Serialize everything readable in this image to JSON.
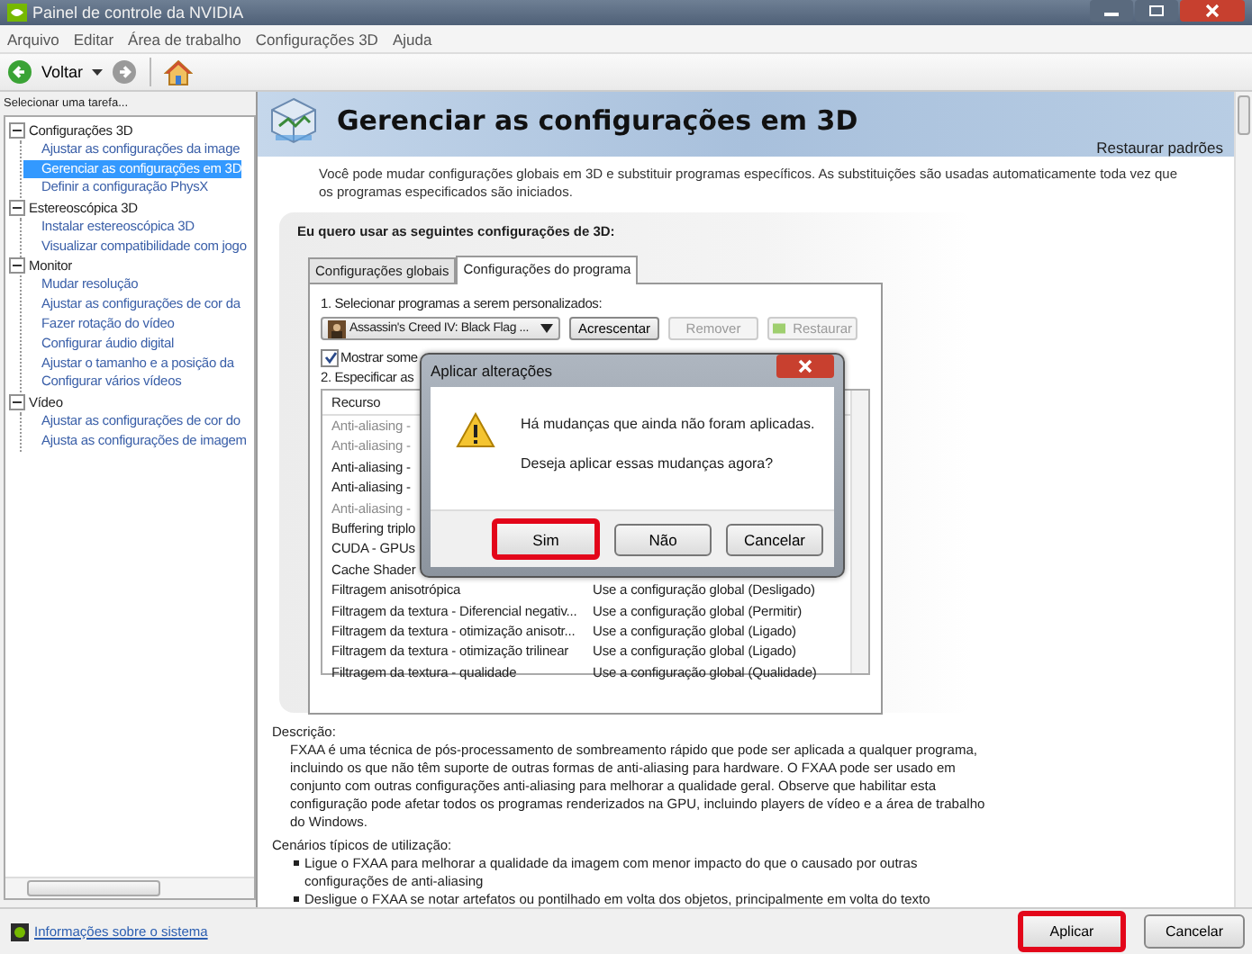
{
  "window": {
    "title": "Painel de controle da NVIDIA"
  },
  "menu": [
    "Arquivo",
    "Editar",
    "Área de trabalho",
    "Configurações 3D",
    "Ajuda"
  ],
  "toolbar": {
    "back_label": "Voltar"
  },
  "sidebar": {
    "heading": "Selecionar uma tarefa...",
    "tree": [
      {
        "label": "Configurações 3D",
        "expanded": true,
        "children": [
          {
            "label": "Ajustar as configurações da image",
            "selected": false
          },
          {
            "label": "Gerenciar as configurações em 3D",
            "selected": true
          },
          {
            "label": "Definir a configuração PhysX",
            "selected": false
          }
        ]
      },
      {
        "label": "Estereoscópica 3D",
        "expanded": true,
        "children": [
          {
            "label": "Instalar estereoscópica 3D",
            "selected": false
          },
          {
            "label": "Visualizar compatibilidade com jogo",
            "selected": false
          }
        ]
      },
      {
        "label": "Monitor",
        "expanded": true,
        "children": [
          {
            "label": "Mudar resolução",
            "selected": false
          },
          {
            "label": "Ajustar as configurações de cor da",
            "selected": false
          },
          {
            "label": "Fazer rotação do vídeo",
            "selected": false
          },
          {
            "label": "Configurar áudio digital",
            "selected": false
          },
          {
            "label": "Ajustar o tamanho e a posição da",
            "selected": false
          },
          {
            "label": "Configurar vários vídeos",
            "selected": false
          }
        ]
      },
      {
        "label": "Vídeo",
        "expanded": true,
        "children": [
          {
            "label": "Ajustar as configurações de cor do",
            "selected": false
          },
          {
            "label": "Ajusta as configurações de imagem",
            "selected": false
          }
        ]
      }
    ]
  },
  "page": {
    "title": "Gerenciar as configurações em 3D",
    "restore_link": "Restaurar padrões",
    "intro": "Você pode mudar configurações globais em 3D e substituir programas específicos. As substituições são usadas automaticamente toda vez que os programas especificados são iniciados.",
    "settings": {
      "heading": "Eu quero usar as seguintes configurações de 3D:",
      "tabs": [
        {
          "label": "Configurações globais",
          "selected": false
        },
        {
          "label": "Configurações do programa",
          "selected": true
        }
      ],
      "step1": "1. Selecionar programas a serem personalizados:",
      "program": "Assassin's Creed IV: Black Flag ...",
      "buttons": [
        {
          "label": "Acrescentar",
          "disabled": false
        },
        {
          "label": "Remover",
          "disabled": true
        },
        {
          "label": "Restaurar",
          "disabled": true
        }
      ],
      "show_only": {
        "label": "Mostrar some",
        "checked": true
      },
      "step2": "2. Especificar as",
      "table": {
        "columns": [
          "Recurso"
        ],
        "rows": [
          {
            "feature": "Anti-aliasing -",
            "disabled": true
          },
          {
            "feature": "Anti-aliasing -",
            "disabled": true
          },
          {
            "feature": "Anti-aliasing -",
            "disabled": false
          },
          {
            "feature": "Anti-aliasing -",
            "disabled": false
          },
          {
            "feature": "Anti-aliasing -",
            "disabled": true
          },
          {
            "feature": "Buffering triplo",
            "disabled": false
          },
          {
            "feature": "CUDA - GPUs",
            "disabled": false
          },
          {
            "feature": "Cache Shader",
            "disabled": false
          },
          {
            "feature": "Filtragem anisotrópica",
            "setting": "Use a configuração global (Desligado)",
            "disabled": false
          },
          {
            "feature": "Filtragem da textura - Diferencial negativ...",
            "setting": "Use a configuração global (Permitir)",
            "disabled": false
          },
          {
            "feature": "Filtragem da textura - otimização anisotr...",
            "setting": "Use a configuração global (Ligado)",
            "disabled": false
          },
          {
            "feature": "Filtragem da textura - otimização trilinear",
            "setting": "Use a configuração global (Ligado)",
            "disabled": false
          },
          {
            "feature": "Filtragem da textura - qualidade",
            "setting": "Use a configuração global (Qualidade)",
            "disabled": false
          }
        ]
      }
    },
    "description": {
      "heading": "Descrição:",
      "text": "FXAA é uma técnica de pós-processamento de sombreamento rápido que pode ser aplicada a qualquer programa, incluindo os que não têm suporte de outras formas de anti-aliasing para hardware. O FXAA pode ser usado em conjunto com outras configurações anti-aliasing para melhorar a qualidade geral. Observe que habilitar esta configuração pode afetar todos os programas renderizados na GPU, incluindo players de vídeo e a área de trabalho do Windows.",
      "scenarios_heading": "Cenários típicos de utilização:",
      "scenarios": [
        "Ligue o FXAA para melhorar a qualidade da imagem com menor impacto do que o causado por outras configurações de anti-aliasing",
        "Desligue o FXAA se notar artefatos ou pontilhado em volta dos objetos, principalmente em volta do texto"
      ]
    }
  },
  "dialog": {
    "title": "Aplicar alterações",
    "message": "Há mudanças que ainda não foram aplicadas.",
    "question": "Deseja aplicar essas mudanças agora?",
    "buttons": [
      {
        "label": "Sim",
        "highlighted": true
      },
      {
        "label": "Não",
        "highlighted": false
      },
      {
        "label": "Cancelar",
        "highlighted": false
      }
    ]
  },
  "status": {
    "link": "Informações sobre o sistema"
  },
  "footer_buttons": [
    {
      "label": "Aplicar",
      "highlighted": true
    },
    {
      "label": "Cancelar",
      "highlighted": false
    }
  ]
}
